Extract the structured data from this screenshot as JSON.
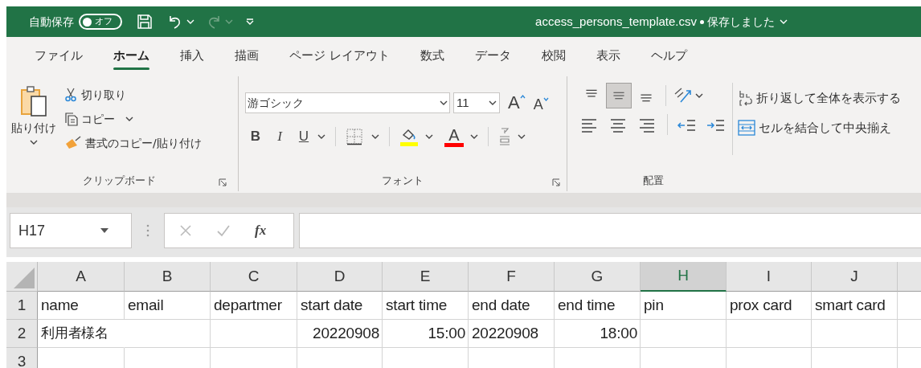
{
  "title_bar": {
    "autosave_label": "自動保存",
    "autosave_toggle": {
      "label": "オフ",
      "on": false
    },
    "file_name": "access_persons_template.csv",
    "save_status": "保存しました"
  },
  "menu_tabs": [
    {
      "label": "ファイル",
      "selected": false
    },
    {
      "label": "ホーム",
      "selected": true
    },
    {
      "label": "挿入",
      "selected": false
    },
    {
      "label": "描画",
      "selected": false
    },
    {
      "label": "ページ レイアウト",
      "selected": false
    },
    {
      "label": "数式",
      "selected": false
    },
    {
      "label": "データ",
      "selected": false
    },
    {
      "label": "校閲",
      "selected": false
    },
    {
      "label": "表示",
      "selected": false
    },
    {
      "label": "ヘルプ",
      "selected": false
    }
  ],
  "ribbon": {
    "clipboard": {
      "paste_label": "貼り付け",
      "cut": "切り取り",
      "copy": "コピー",
      "format_painter": "書式のコピー/貼り付け",
      "group_label": "クリップボード"
    },
    "font": {
      "font_name": "游ゴシック",
      "font_size": "11",
      "grow": "A",
      "shrink": "A",
      "bold": "B",
      "italic": "I",
      "underline": "U",
      "font_color": "A",
      "group_label": "フォント"
    },
    "alignment": {
      "vertical_buttons": [
        {
          "kind": "top",
          "selected": false
        },
        {
          "kind": "middle",
          "selected": true
        },
        {
          "kind": "bottom",
          "selected": false
        }
      ],
      "wrap_text": "折り返して全体を表示する",
      "merge_center": "セルを結合して中央揃え",
      "group_label": "配置"
    }
  },
  "formula_bar": {
    "name_box": "H17",
    "function_label": "fx"
  },
  "sheet": {
    "columns": [
      {
        "label": "A",
        "selected": false
      },
      {
        "label": "B",
        "selected": false
      },
      {
        "label": "C",
        "selected": false
      },
      {
        "label": "D",
        "selected": false
      },
      {
        "label": "E",
        "selected": false
      },
      {
        "label": "F",
        "selected": false
      },
      {
        "label": "G",
        "selected": false
      },
      {
        "label": "H",
        "selected": true
      },
      {
        "label": "I",
        "selected": false
      },
      {
        "label": "J",
        "selected": false
      }
    ],
    "rows": [
      {
        "number": "1",
        "cells": [
          {
            "text": "name",
            "right_aligned": false
          },
          {
            "text": "email",
            "right_aligned": false
          },
          {
            "text": "departmer",
            "right_aligned": false
          },
          {
            "text": "start date",
            "right_aligned": false
          },
          {
            "text": "start time",
            "right_aligned": false
          },
          {
            "text": "end date",
            "right_aligned": false
          },
          {
            "text": "end time",
            "right_aligned": false
          },
          {
            "text": "pin",
            "right_aligned": false
          },
          {
            "text": "prox card",
            "right_aligned": false
          },
          {
            "text": "smart card",
            "right_aligned": false
          }
        ]
      },
      {
        "number": "2",
        "cells": [
          {
            "text": "利用者様名",
            "right_aligned": false
          },
          null,
          null,
          {
            "text": "20220908",
            "right_aligned": true
          },
          {
            "text": "15:00",
            "right_aligned": true
          },
          {
            "text": "20220908",
            "right_aligned": false
          },
          {
            "text": "18:00",
            "right_aligned": true
          },
          null,
          null,
          null
        ]
      },
      {
        "number": "3",
        "cells": [
          null,
          null,
          null,
          null,
          null,
          null,
          null,
          null,
          null,
          null
        ]
      }
    ]
  }
}
